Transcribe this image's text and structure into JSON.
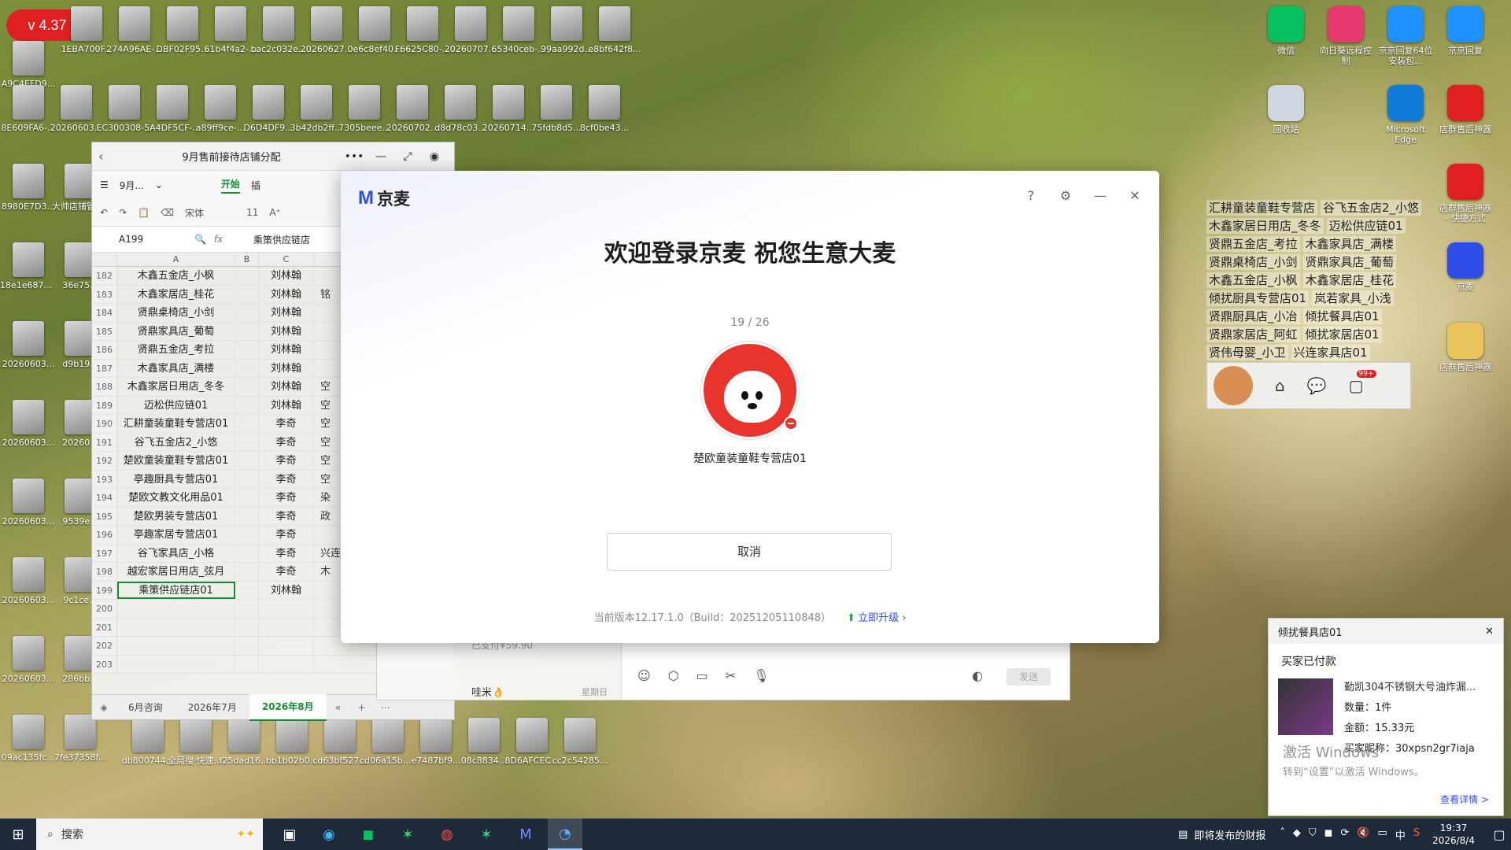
{
  "version_badge": "v 4.37",
  "desktop_icons_row1": [
    "A9C4EFD9...",
    "1EBA700F...",
    "274A96AE-...",
    "DBF02F95...",
    "61b4f4a2-...",
    "bac2c032e...",
    "20260627...",
    "0e6c8ef40...",
    "F6625C80-...",
    "20260707...",
    "65340ceb-...",
    "99aa992d...",
    "e8bf642f8..."
  ],
  "desktop_icons_row2": [
    "8E609FA6-...",
    "20260603...",
    "EC300308-...",
    "5A4DF5CF-...",
    "a89ff9ce-...",
    "D6D4DF9...",
    "3b42db2ff...",
    "7305beee...",
    "20260702...",
    "d8d78c03...",
    "20260714...",
    "75fdb8d5...",
    "8cf0be43..."
  ],
  "desktop_left_col": [
    "8980E7D3...",
    "18e1e687c...",
    "20260603...",
    "20260603...",
    "20260603...",
    "20260603...",
    "20260603...",
    "09ac135fc..."
  ],
  "desktop_second_col": [
    "大帅店铺管理系统",
    "36e75...",
    "d9b19...",
    "20260...",
    "9539e...",
    "9c1ce...",
    "286bb...",
    "7fe37358f..."
  ],
  "desktop_bottom_row": [
    "db800744...",
    "全局搜·快速启动器",
    "f25dad16...",
    "bb1b02b0...",
    "cd63bf527...",
    "cd06a15b8...",
    "e7487bf9...",
    "08c8834...",
    "8D6AFCEC...",
    "cc2c54285..."
  ],
  "right_apps": [
    {
      "label": "微信",
      "color": "#07c160",
      "icon": "wechat-icon"
    },
    {
      "label": "向日葵远程控制",
      "color": "#e8386d",
      "icon": "sunflower-icon"
    },
    {
      "label": "京京回复64位安装包...",
      "color": "#1e90ff",
      "icon": "jd-reply-icon"
    },
    {
      "label": "京京回复",
      "color": "#1e90ff",
      "icon": "jd-reply-icon"
    },
    {
      "label": "回收站",
      "color": "#cfd8e0",
      "icon": "recycle-bin-icon"
    },
    {
      "label": "Microsoft Edge",
      "color": "#0f7ad8",
      "icon": "edge-icon"
    },
    {
      "label": "店群售后神器",
      "color": "#e02020",
      "icon": "aftersales-icon"
    },
    {
      "label": "店群售后神器 - 快捷方式",
      "color": "#e02020",
      "icon": "aftersales-icon"
    },
    {
      "label": "京麦",
      "color": "#2d4ee8",
      "icon": "jingmai-icon"
    },
    {
      "label": "店群售后神器",
      "color": "#e8c45a",
      "icon": "folder-icon"
    }
  ],
  "sheet": {
    "title": "9月售前接待店铺分配",
    "toolbar_start": "开始",
    "toolbar_insert": "插",
    "menu_label": "9月...",
    "font_name": "宋体",
    "font_size": "11",
    "cell_ref": "A199",
    "formula": "乘策供应链店",
    "columns": [
      "A",
      "B",
      "C"
    ],
    "rows": [
      {
        "n": "182",
        "a": "木鑫五金店_小枫",
        "c": "刘林翰",
        "d": ""
      },
      {
        "n": "183",
        "a": "木鑫家居店_桂花",
        "c": "刘林翰",
        "d": "铭"
      },
      {
        "n": "184",
        "a": "贤鼎桌椅店_小剑",
        "c": "刘林翰",
        "d": ""
      },
      {
        "n": "185",
        "a": "贤鼎家具店_葡萄",
        "c": "刘林翰",
        "d": ""
      },
      {
        "n": "186",
        "a": "贤鼎五金店_考拉",
        "c": "刘林翰",
        "d": ""
      },
      {
        "n": "187",
        "a": "木鑫家具店_满楼",
        "c": "刘林翰",
        "d": ""
      },
      {
        "n": "188",
        "a": "木鑫家居日用店_冬冬",
        "c": "刘林翰",
        "d": "空"
      },
      {
        "n": "189",
        "a": "迈松供应链01",
        "c": "刘林翰",
        "d": "空"
      },
      {
        "n": "190",
        "a": "汇耕童装童鞋专营店01",
        "c": "李奇",
        "d": "空"
      },
      {
        "n": "191",
        "a": "谷飞五金店2_小悠",
        "c": "李奇",
        "d": "空"
      },
      {
        "n": "192",
        "a": "楚欧童装童鞋专营店01",
        "c": "李奇",
        "d": "空"
      },
      {
        "n": "193",
        "a": "亭趣厨具专营店01",
        "c": "李奇",
        "d": "空"
      },
      {
        "n": "194",
        "a": "楚欧文教文化用品01",
        "c": "李奇",
        "d": "染"
      },
      {
        "n": "195",
        "a": "楚欧男装专营店01",
        "c": "李奇",
        "d": "政"
      },
      {
        "n": "196",
        "a": "亭趣家居专营店01",
        "c": "李奇",
        "d": ""
      },
      {
        "n": "197",
        "a": "谷飞家具店_小格",
        "c": "李奇",
        "d": "兴连"
      },
      {
        "n": "198",
        "a": "越宏家居日用店_弦月",
        "c": "李奇",
        "d": "木"
      },
      {
        "n": "199",
        "a": "乘策供应链店01",
        "c": "刘林翰",
        "d": ""
      },
      {
        "n": "200",
        "a": "",
        "c": "",
        "d": ""
      },
      {
        "n": "201",
        "a": "",
        "c": "",
        "d": ""
      },
      {
        "n": "202",
        "a": "",
        "c": "",
        "d": ""
      },
      {
        "n": "203",
        "a": "",
        "c": "",
        "d": ""
      }
    ],
    "tabs": [
      "6月咨询",
      "2026年7月",
      "2026年8月"
    ]
  },
  "chat": {
    "paid": "已支付¥59.90",
    "contact": "哇米👌",
    "day": "星期日",
    "send": "发送"
  },
  "login": {
    "brand": "京麦",
    "welcome": "欢迎登录京麦 祝您生意大麦",
    "counter": "19 / 26",
    "shop_name": "楚欧童装童鞋专营店01",
    "cancel": "取消",
    "version": "当前版本12.17.1.0（Build：20251205110848）",
    "upgrade": "立即升级"
  },
  "float_list": [
    [
      "汇耕童装童鞋专营店",
      "谷飞五金店2_小悠"
    ],
    [
      "木鑫家居日用店_冬冬",
      "迈松供应链01"
    ],
    [
      "贤鼎五金店_考拉",
      "木鑫家具店_满楼"
    ],
    [
      "贤鼎桌椅店_小剑",
      "贤鼎家具店_葡萄"
    ],
    [
      "木鑫五金店_小枫",
      "木鑫家居店_桂花"
    ],
    [
      "倾扰厨具专营店01",
      "岚若家具_小浅"
    ],
    [
      "贤鼎厨具店_小冶",
      "倾扰餐具店01"
    ],
    [
      "贤鼎家居店_阿虹",
      "倾扰家居店01"
    ],
    [
      "贤伟母婴_小卫",
      "兴连家具店01"
    ]
  ],
  "float_bar_badge": "99+",
  "notification": {
    "shop": "倾扰餐具店01",
    "title": "买家已付款",
    "product": "勤凯304不锈钢大号油炸漏...",
    "qty": "数量：1件",
    "amount": "金额：15.33元",
    "buyer": "买家昵称：30xpsn2gr7iaja",
    "activate": "激活 Windows",
    "activate_hint": "转到“设置”以激活 Windows。",
    "more": "查看详情 >"
  },
  "taskbar": {
    "search": "搜索",
    "news": "即将发布的财报",
    "time": "19:37",
    "date": "2026/8/4",
    "ime": "中"
  }
}
